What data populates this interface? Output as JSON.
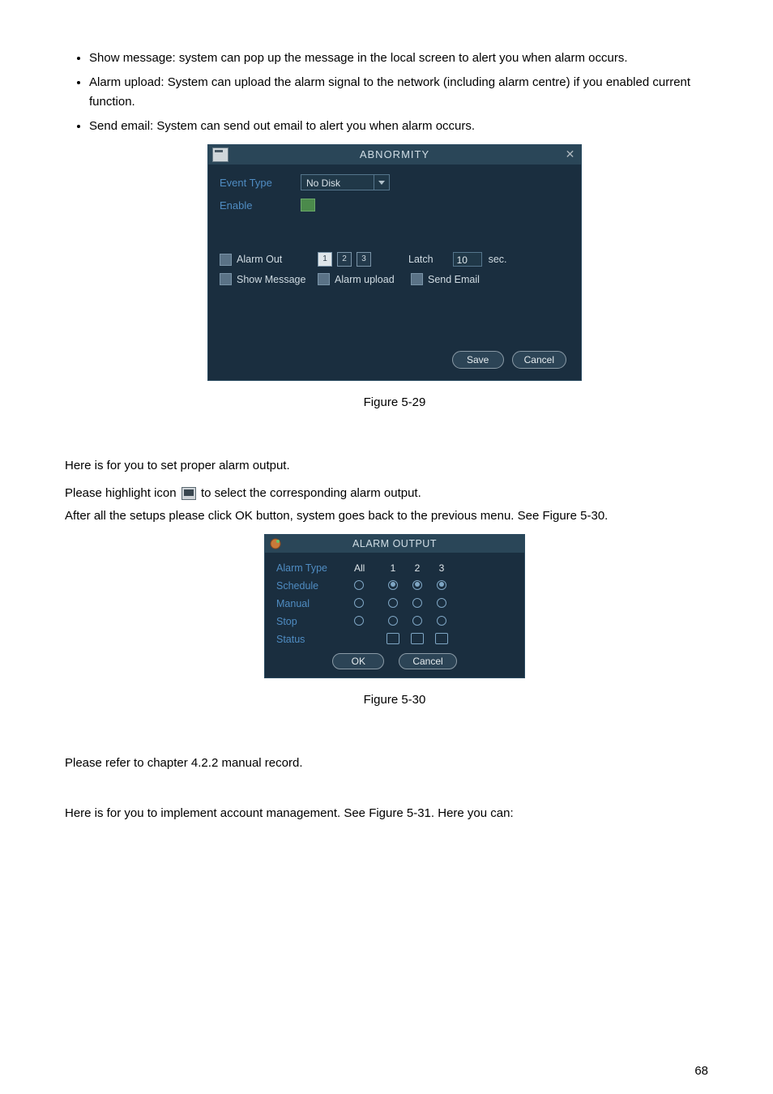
{
  "bullets": {
    "b0": "Show message: system can pop up the message in the local screen to alert you when alarm occurs.",
    "b1": "Alarm upload: System can upload the alarm signal to the network (including alarm centre) if you enabled current function.",
    "b2": "Send email: System can send out email to alert you when alarm occurs."
  },
  "abn": {
    "title": "ABNORMITY",
    "event_type_label": "Event Type",
    "event_type_value": "No Disk",
    "enable_label": "Enable",
    "alarm_out_label": "Alarm Out",
    "latch_label": "Latch",
    "latch_value": "10",
    "latch_unit": "sec.",
    "show_message": "Show Message",
    "alarm_upload": "Alarm upload",
    "send_email": "Send Email",
    "num1": "1",
    "num2": "2",
    "num3": "3",
    "save": "Save",
    "cancel": "Cancel"
  },
  "fig1": "Figure 5-29",
  "para1": "Here is for you to set proper alarm output.",
  "para2a": "Please highlight icon ",
  "para2b": " to select the corresponding alarm output.",
  "para3": "After all the setups please click OK button, system goes back to the previous menu. See Figure 5-30.",
  "ao": {
    "title": "ALARM OUTPUT",
    "alarm_type": "Alarm Type",
    "all": "All",
    "c1": "1",
    "c2": "2",
    "c3": "3",
    "schedule": "Schedule",
    "manual": "Manual",
    "stop": "Stop",
    "status": "Status",
    "ok": "OK",
    "cancel": "Cancel"
  },
  "fig2": "Figure 5-30",
  "para4": "Please refer to chapter 4.2.2 manual record.",
  "para5": "Here is for you to implement account management.  See Figure 5-31. Here you can:",
  "pagenum": "68",
  "chart_data": null
}
